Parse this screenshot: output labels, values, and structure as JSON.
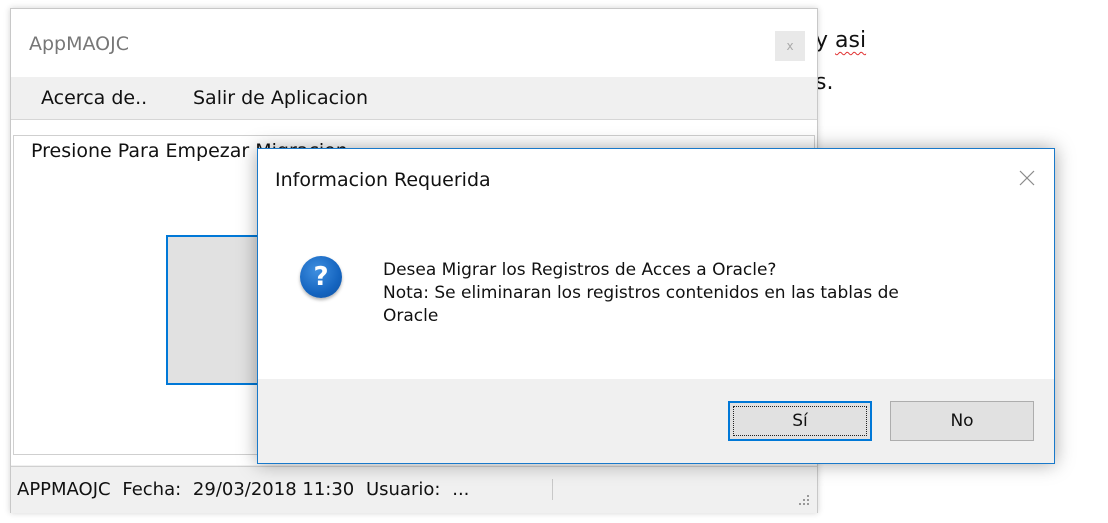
{
  "background_document": {
    "line1_prefix": "y ",
    "line1_word": "asi",
    "line2_fragment": "s."
  },
  "app_window": {
    "title": "AppMAOJC",
    "close_glyph": "x",
    "menu": [
      {
        "label": "Acerca de.."
      },
      {
        "label": "Salir de Aplicacion"
      }
    ],
    "group_label": "Presione Para Empezar Migracion",
    "status_bar": {
      "app": "APPMAOJC",
      "fecha_label": "Fecha:",
      "fecha_value": "29/03/2018 11:30",
      "usuario_label": "Usuario:",
      "usuario_value": "..."
    }
  },
  "dialog": {
    "title": "Informacion Requerida",
    "icon": "question-icon",
    "icon_glyph": "?",
    "message_line1": "Desea Migrar los Registros de Acces a Oracle?",
    "message_line2": "Nota: Se eliminaran los registros contenidos en las tablas de",
    "message_line3": "Oracle",
    "buttons": {
      "yes": "Sí",
      "no": "No"
    }
  },
  "colors": {
    "accent": "#0078d7",
    "dialog_border": "#1979ca",
    "icon_blue": "#1565c0",
    "chrome": "#f0f0f0"
  }
}
